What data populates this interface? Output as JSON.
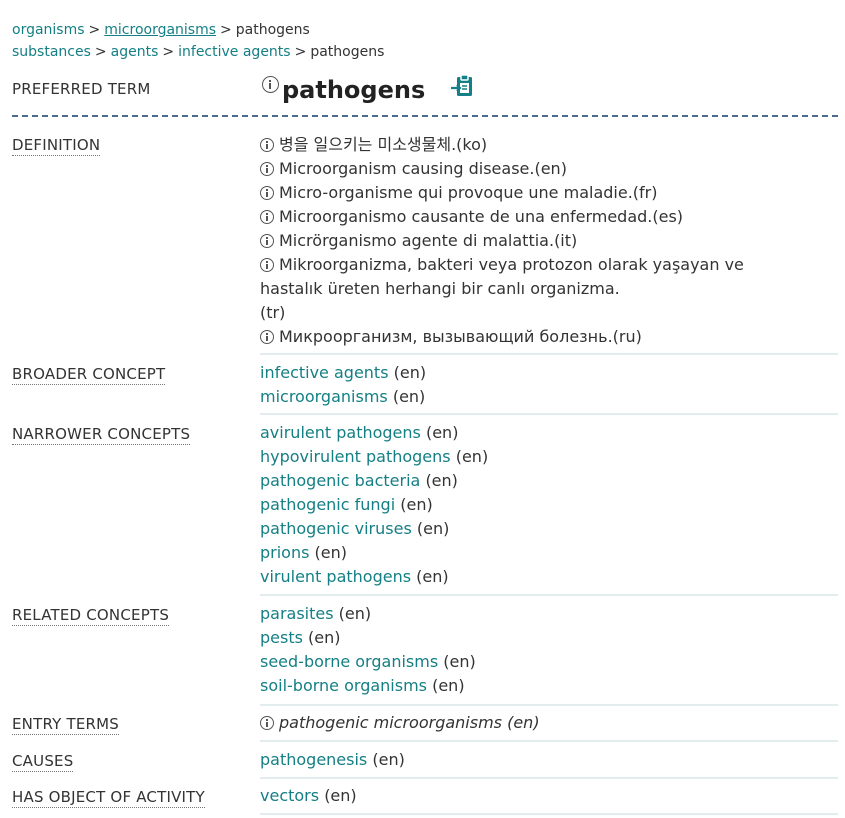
{
  "breadcrumbs": {
    "line1": [
      "organisms",
      "microorganisms",
      "pathogens"
    ],
    "line2": [
      "substances",
      "agents",
      "infective agents",
      "pathogens"
    ],
    "separator": ">"
  },
  "preferred_term": {
    "label": "PREFERRED TERM",
    "value": "pathogens"
  },
  "definition": {
    "label": "DEFINITION",
    "items": [
      "병을 일으키는 미소생물체.(ko)",
      "Microorganism causing disease.(en)",
      "Micro-organisme qui provoque une maladie.(fr)",
      "Microorganismo causante de una enfermedad.(es)",
      "Micrörganismo agente di malattia.(it)",
      "Mikroorganizma, bakteri veya protozon olarak yaşayan ve hastalık üreten herhangi bir canlı organizma.",
      "(tr)",
      "Микроорганизм, вызывающий болезнь.(ru)"
    ]
  },
  "broader": {
    "label": "BROADER CONCEPT",
    "items": [
      {
        "term": "infective agents",
        "lang": "(en)"
      },
      {
        "term": "microorganisms",
        "lang": "(en)"
      }
    ]
  },
  "narrower": {
    "label": "NARROWER CONCEPTS",
    "items": [
      {
        "term": "avirulent pathogens",
        "lang": "(en)"
      },
      {
        "term": "hypovirulent pathogens",
        "lang": "(en)"
      },
      {
        "term": "pathogenic bacteria",
        "lang": "(en)"
      },
      {
        "term": "pathogenic fungi",
        "lang": "(en)"
      },
      {
        "term": "pathogenic viruses",
        "lang": "(en)"
      },
      {
        "term": "prions",
        "lang": "(en)"
      },
      {
        "term": "virulent pathogens",
        "lang": "(en)"
      }
    ]
  },
  "related": {
    "label": "RELATED CONCEPTS",
    "items": [
      {
        "term": "parasites",
        "lang": "(en)"
      },
      {
        "term": "pests",
        "lang": "(en)"
      },
      {
        "term": "seed-borne organisms",
        "lang": "(en)"
      },
      {
        "term": "soil-borne organisms",
        "lang": "(en)"
      }
    ]
  },
  "entry_terms": {
    "label": "ENTRY TERMS",
    "value": "pathogenic microorganisms (en)"
  },
  "causes": {
    "label": "CAUSES",
    "items": [
      {
        "term": "pathogenesis",
        "lang": "(en)"
      }
    ]
  },
  "has_object": {
    "label": "HAS OBJECT OF ACTIVITY",
    "items": [
      {
        "term": "vectors",
        "lang": "(en)"
      }
    ]
  },
  "colors": {
    "link": "#147f84",
    "text": "#333333",
    "divider": "#e3eded",
    "dash": "#4b6b8c"
  },
  "icons": {
    "info": "info-circle-icon",
    "copy": "clipboard-copy-icon"
  }
}
